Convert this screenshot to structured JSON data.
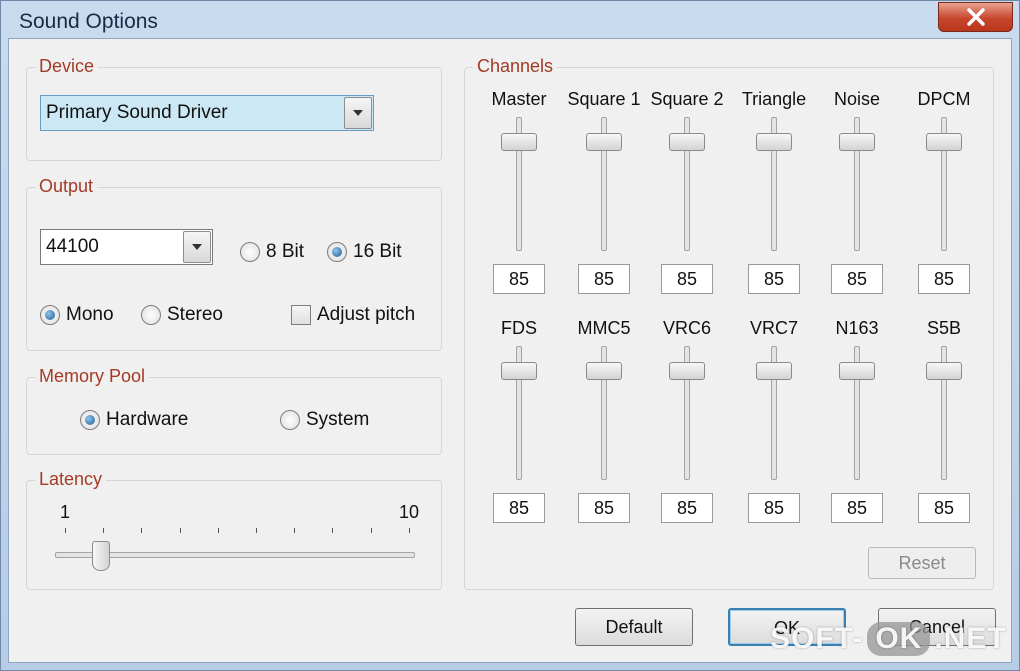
{
  "window": {
    "title": "Sound Options",
    "close_icon": "close-icon"
  },
  "device": {
    "label": "Device",
    "selected": "Primary Sound Driver"
  },
  "output": {
    "label": "Output",
    "sample_rate": "44100",
    "bit8_label": "8 Bit",
    "bit16_label": "16 Bit",
    "mono_label": "Mono",
    "stereo_label": "Stereo",
    "adjust_pitch_label": "Adjust pitch"
  },
  "memory_pool": {
    "label": "Memory Pool",
    "hardware_label": "Hardware",
    "system_label": "System"
  },
  "latency": {
    "label": "Latency",
    "min_label": "1",
    "max_label": "10",
    "value": 2
  },
  "channels": {
    "label": "Channels",
    "row1": [
      {
        "name": "Master",
        "value": "85"
      },
      {
        "name": "Square 1",
        "value": "85"
      },
      {
        "name": "Square 2",
        "value": "85"
      },
      {
        "name": "Triangle",
        "value": "85"
      },
      {
        "name": "Noise",
        "value": "85"
      },
      {
        "name": "DPCM",
        "value": "85"
      }
    ],
    "row2": [
      {
        "name": "FDS",
        "value": "85"
      },
      {
        "name": "MMC5",
        "value": "85"
      },
      {
        "name": "VRC6",
        "value": "85"
      },
      {
        "name": "VRC7",
        "value": "85"
      },
      {
        "name": "N163",
        "value": "85"
      },
      {
        "name": "S5B",
        "value": "85"
      }
    ],
    "reset_label": "Reset"
  },
  "buttons": {
    "default_label": "Default",
    "ok_label": "OK",
    "cancel_label": "Cancel"
  },
  "watermark": {
    "left": "SOFT-",
    "mid": "OK",
    "right": ".NET"
  },
  "colors": {
    "group_label": "#a33a26",
    "accent": "#3c7fb1"
  }
}
